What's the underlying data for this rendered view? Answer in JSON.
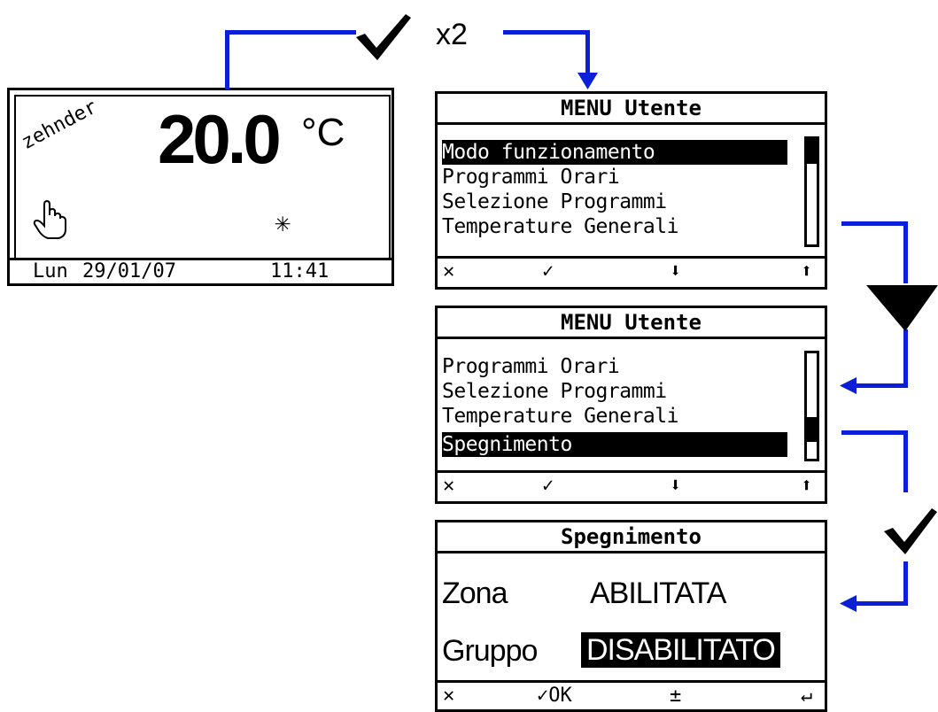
{
  "home_screen": {
    "brand": "zehnder",
    "temperature": "20.0",
    "unit": "°C",
    "day": "Lun",
    "date": "29/01/07",
    "time": "11:41",
    "manual_icon": "hand-pointer-icon",
    "mode_icon": "snowflake-icon"
  },
  "annotation": {
    "confirm_label": "x2",
    "confirm_icon": "checkmark-icon",
    "down_icon": "down-triangle-icon",
    "line_color": "#0b1fd8"
  },
  "menu1": {
    "title": "MENU Utente",
    "items": [
      "Modo funzionamento",
      "Programmi Orari",
      "Selezione Programmi",
      "Temperature Generali"
    ],
    "selected_index": 0,
    "softkeys": [
      "✕",
      "✓",
      "⬇",
      "⬆"
    ]
  },
  "menu2": {
    "title": "MENU Utente",
    "items": [
      "Programmi Orari",
      "Selezione Programmi",
      "Temperature Generali",
      "Spegnimento"
    ],
    "selected_index": 3,
    "softkeys": [
      "✕",
      "✓",
      "⬇",
      "⬆"
    ]
  },
  "shutdown": {
    "title": "Spegnimento",
    "rows": [
      {
        "label": "Zona",
        "value": "ABILITATA",
        "selected": false
      },
      {
        "label": "Gruppo",
        "value": "DISABILITATO",
        "selected": true
      }
    ],
    "softkeys": [
      "✕",
      "✓OK",
      "±",
      "↵"
    ]
  }
}
